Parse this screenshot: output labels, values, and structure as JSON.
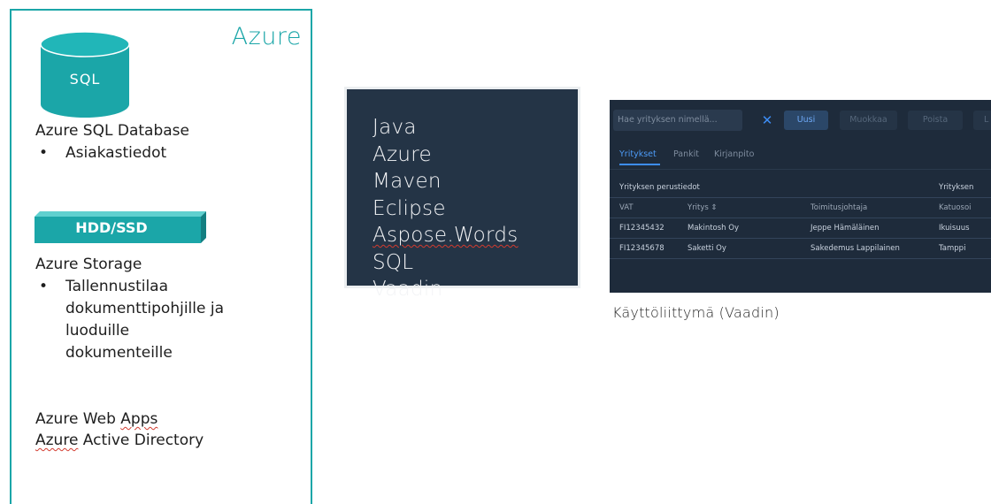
{
  "azure": {
    "title": "Azure",
    "db_label": "SQL",
    "sql_heading": "Azure SQL Database",
    "sql_bullets": [
      "Asiakastiedot"
    ],
    "storage_label": "HDD/SSD",
    "storage_heading": "Azure Storage",
    "storage_bullet_lines": [
      "Tallennustilaa",
      "dokumenttipohjille ja",
      "luoduille",
      "dokumenteille"
    ],
    "web_apps": "Azure Web Apps",
    "active_directory": "Azure Active Directory",
    "accent_color": "#1ba6a8"
  },
  "tech_stack": [
    "Java",
    "Azure",
    "Maven",
    "Eclipse",
    "Aspose.Words",
    "SQL",
    "Vaadin"
  ],
  "ui": {
    "search_placeholder": "Hae yrityksen nimellä...",
    "clear_icon": "close-icon",
    "buttons": {
      "new": "Uusi",
      "edit": "Muokkaa",
      "delete": "Poista",
      "extra": "L"
    },
    "tabs": [
      "Yritykset",
      "Pankit",
      "Kirjanpito"
    ],
    "groups": {
      "basic": "Yrityksen perustiedot",
      "second": "Yrityksen"
    },
    "columns": {
      "vat": "VAT",
      "company": "Yritys ⇕",
      "ceo": "Toimitusjohtaja",
      "street": "Katuosoi"
    },
    "rows": [
      {
        "vat": "FI12345432",
        "company": "Makintosh Oy",
        "ceo": "Jeppe Hämäläinen",
        "street": "Ikuisuus"
      },
      {
        "vat": "FI12345678",
        "company": "Saketti Oy",
        "ceo": "Sakedemus Lappilainen",
        "street": "Tamppi"
      }
    ]
  },
  "caption": "Käyttöliittymä (Vaadin)"
}
